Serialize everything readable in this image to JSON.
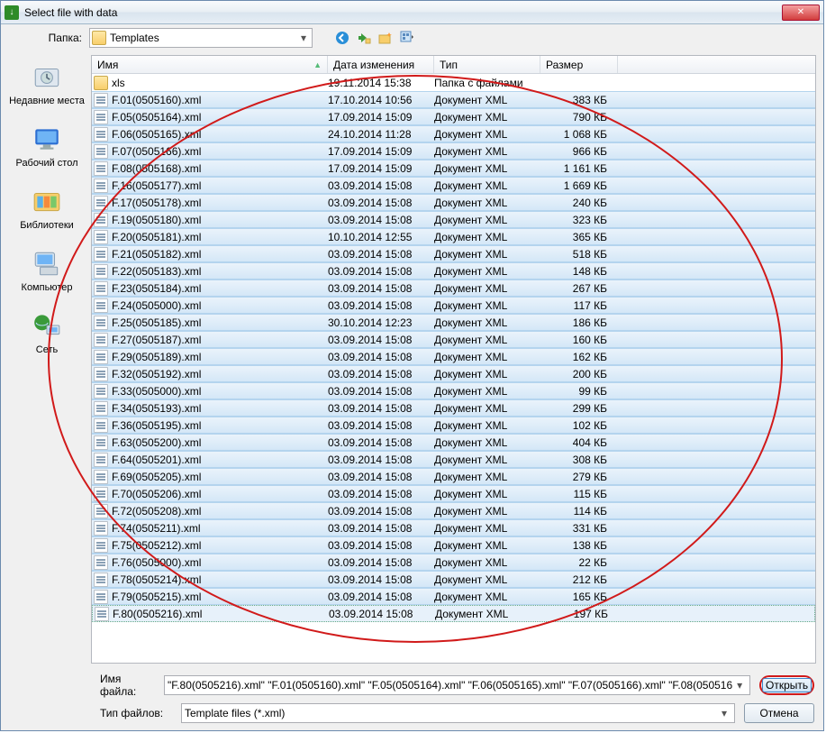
{
  "window": {
    "title": "Select file with data"
  },
  "toolbar": {
    "folder_label": "Папка:",
    "folder_value": "Templates"
  },
  "columns": {
    "name": "Имя",
    "date": "Дата изменения",
    "type": "Тип",
    "size": "Размер"
  },
  "places": [
    {
      "label": "Недавние места"
    },
    {
      "label": "Рабочий стол"
    },
    {
      "label": "Библиотеки"
    },
    {
      "label": "Компьютер"
    },
    {
      "label": "Сеть"
    }
  ],
  "folderRow": {
    "name": "xls",
    "date": "19.11.2014 15:38",
    "type": "Папка с файлами",
    "size": ""
  },
  "files": [
    {
      "name": "F.01(0505160).xml",
      "date": "17.10.2014 10:56",
      "type": "Документ XML",
      "size": "383 КБ"
    },
    {
      "name": "F.05(0505164).xml",
      "date": "17.09.2014 15:09",
      "type": "Документ XML",
      "size": "790 КБ"
    },
    {
      "name": "F.06(0505165).xml",
      "date": "24.10.2014 11:28",
      "type": "Документ XML",
      "size": "1 068 КБ"
    },
    {
      "name": "F.07(0505166).xml",
      "date": "17.09.2014 15:09",
      "type": "Документ XML",
      "size": "966 КБ"
    },
    {
      "name": "F.08(0505168).xml",
      "date": "17.09.2014 15:09",
      "type": "Документ XML",
      "size": "1 161 КБ"
    },
    {
      "name": "F.16(0505177).xml",
      "date": "03.09.2014 15:08",
      "type": "Документ XML",
      "size": "1 669 КБ"
    },
    {
      "name": "F.17(0505178).xml",
      "date": "03.09.2014 15:08",
      "type": "Документ XML",
      "size": "240 КБ"
    },
    {
      "name": "F.19(0505180).xml",
      "date": "03.09.2014 15:08",
      "type": "Документ XML",
      "size": "323 КБ"
    },
    {
      "name": "F.20(0505181).xml",
      "date": "10.10.2014 12:55",
      "type": "Документ XML",
      "size": "365 КБ"
    },
    {
      "name": "F.21(0505182).xml",
      "date": "03.09.2014 15:08",
      "type": "Документ XML",
      "size": "518 КБ"
    },
    {
      "name": "F.22(0505183).xml",
      "date": "03.09.2014 15:08",
      "type": "Документ XML",
      "size": "148 КБ"
    },
    {
      "name": "F.23(0505184).xml",
      "date": "03.09.2014 15:08",
      "type": "Документ XML",
      "size": "267 КБ"
    },
    {
      "name": "F.24(0505000).xml",
      "date": "03.09.2014 15:08",
      "type": "Документ XML",
      "size": "117 КБ"
    },
    {
      "name": "F.25(0505185).xml",
      "date": "30.10.2014 12:23",
      "type": "Документ XML",
      "size": "186 КБ"
    },
    {
      "name": "F.27(0505187).xml",
      "date": "03.09.2014 15:08",
      "type": "Документ XML",
      "size": "160 КБ"
    },
    {
      "name": "F.29(0505189).xml",
      "date": "03.09.2014 15:08",
      "type": "Документ XML",
      "size": "162 КБ"
    },
    {
      "name": "F.32(0505192).xml",
      "date": "03.09.2014 15:08",
      "type": "Документ XML",
      "size": "200 КБ"
    },
    {
      "name": "F.33(0505000).xml",
      "date": "03.09.2014 15:08",
      "type": "Документ XML",
      "size": "99 КБ"
    },
    {
      "name": "F.34(0505193).xml",
      "date": "03.09.2014 15:08",
      "type": "Документ XML",
      "size": "299 КБ"
    },
    {
      "name": "F.36(0505195).xml",
      "date": "03.09.2014 15:08",
      "type": "Документ XML",
      "size": "102 КБ"
    },
    {
      "name": "F.63(0505200).xml",
      "date": "03.09.2014 15:08",
      "type": "Документ XML",
      "size": "404 КБ"
    },
    {
      "name": "F.64(0505201).xml",
      "date": "03.09.2014 15:08",
      "type": "Документ XML",
      "size": "308 КБ"
    },
    {
      "name": "F.69(0505205).xml",
      "date": "03.09.2014 15:08",
      "type": "Документ XML",
      "size": "279 КБ"
    },
    {
      "name": "F.70(0505206).xml",
      "date": "03.09.2014 15:08",
      "type": "Документ XML",
      "size": "115 КБ"
    },
    {
      "name": "F.72(0505208).xml",
      "date": "03.09.2014 15:08",
      "type": "Документ XML",
      "size": "114 КБ"
    },
    {
      "name": "F.74(0505211).xml",
      "date": "03.09.2014 15:08",
      "type": "Документ XML",
      "size": "331 КБ"
    },
    {
      "name": "F.75(0505212).xml",
      "date": "03.09.2014 15:08",
      "type": "Документ XML",
      "size": "138 КБ"
    },
    {
      "name": "F.76(0505000).xml",
      "date": "03.09.2014 15:08",
      "type": "Документ XML",
      "size": "22 КБ"
    },
    {
      "name": "F.78(0505214).xml",
      "date": "03.09.2014 15:08",
      "type": "Документ XML",
      "size": "212 КБ"
    },
    {
      "name": "F.79(0505215).xml",
      "date": "03.09.2014 15:08",
      "type": "Документ XML",
      "size": "165 КБ"
    },
    {
      "name": "F.80(0505216).xml",
      "date": "03.09.2014 15:08",
      "type": "Документ XML",
      "size": "197 КБ"
    }
  ],
  "bottom": {
    "filename_label": "Имя файла:",
    "filename_value": "\"F.80(0505216).xml\" \"F.01(0505160).xml\" \"F.05(0505164).xml\" \"F.06(0505165).xml\" \"F.07(0505166).xml\" \"F.08(050516",
    "filetype_label": "Тип файлов:",
    "filetype_value": "Template files (*.xml)",
    "open": "Открыть",
    "cancel": "Отмена"
  }
}
